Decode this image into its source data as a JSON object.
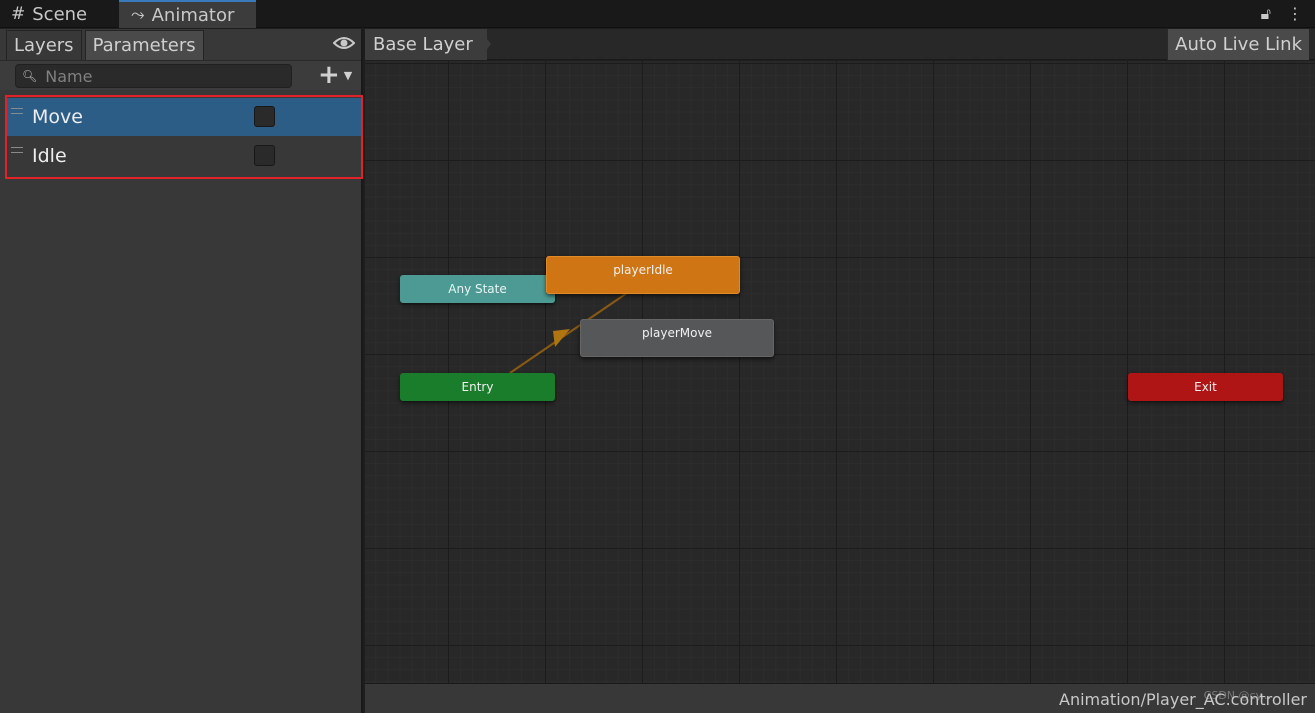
{
  "tabs": [
    {
      "label": "Scene",
      "icon": "grid-icon"
    },
    {
      "label": "Animator",
      "icon": "animator-icon",
      "active": true
    }
  ],
  "window_controls": {
    "lock_icon": "lock-icon",
    "menu_icon": "kebab-menu-icon"
  },
  "left_panel": {
    "subtabs": [
      "Layers",
      "Parameters"
    ],
    "active_subtab": "Parameters",
    "search": {
      "placeholder": "Name",
      "value": ""
    },
    "parameters": [
      {
        "name": "Move",
        "type": "bool",
        "value": false,
        "selected": true
      },
      {
        "name": "Idle",
        "type": "bool",
        "value": false,
        "selected": false
      }
    ]
  },
  "graph": {
    "breadcrumb": "Base Layer",
    "auto_live_link": "Auto Live Link",
    "nodes": {
      "any_state": "Any State",
      "player_idle": "playerIdle",
      "player_move": "playerMove",
      "entry": "Entry",
      "exit": "Exit"
    },
    "colors": {
      "any_state": "#4c9a93",
      "player_idle": "#d07514",
      "player_move": "#555759",
      "entry": "#1a7d2c",
      "exit": "#b01515",
      "transition": "#8a5a12"
    }
  },
  "status_bar": {
    "path": "Animation/Player_AC.controller",
    "watermark": "CSDN @cy..."
  }
}
